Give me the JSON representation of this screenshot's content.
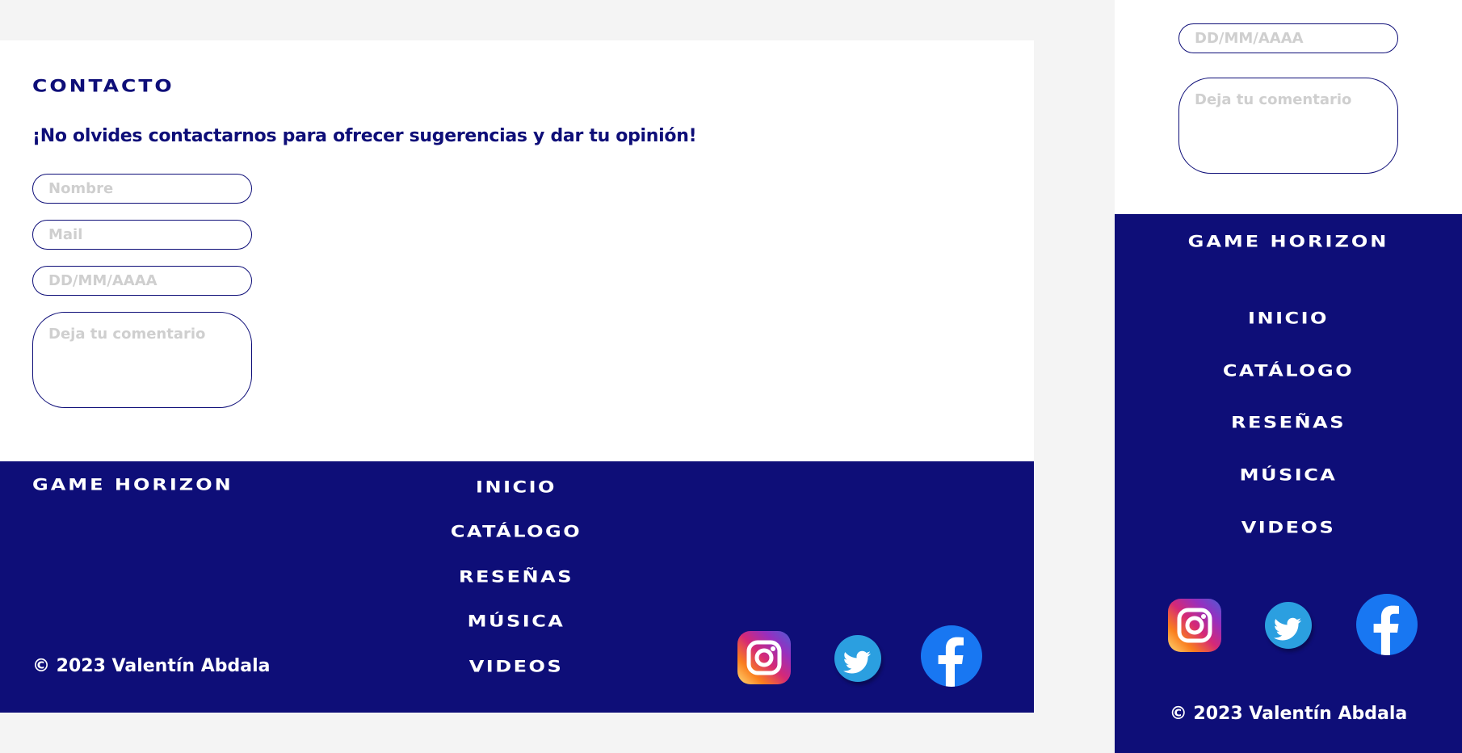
{
  "contact": {
    "title": "CONTACTO",
    "subtitle": "¡No olvides contactarnos para ofrecer sugerencias y dar tu opinión!",
    "placeholders": {
      "name": "Nombre",
      "mail": "Mail",
      "date": "DD/MM/AAAA",
      "comment": "Deja tu comentario"
    }
  },
  "footer": {
    "brand": "GAME HORIZON",
    "nav": [
      "INICIO",
      "CATÁLOGO",
      "RESEÑAS",
      "MÚSICA",
      "VIDEOS"
    ],
    "copyright": "© 2023 Valentín Abdala",
    "social": [
      "instagram-icon",
      "twitter-icon",
      "facebook-icon"
    ]
  },
  "colors": {
    "primary": "#0e0e78",
    "placeholder": "#cfcfcf",
    "background": "#f4f4f4"
  }
}
